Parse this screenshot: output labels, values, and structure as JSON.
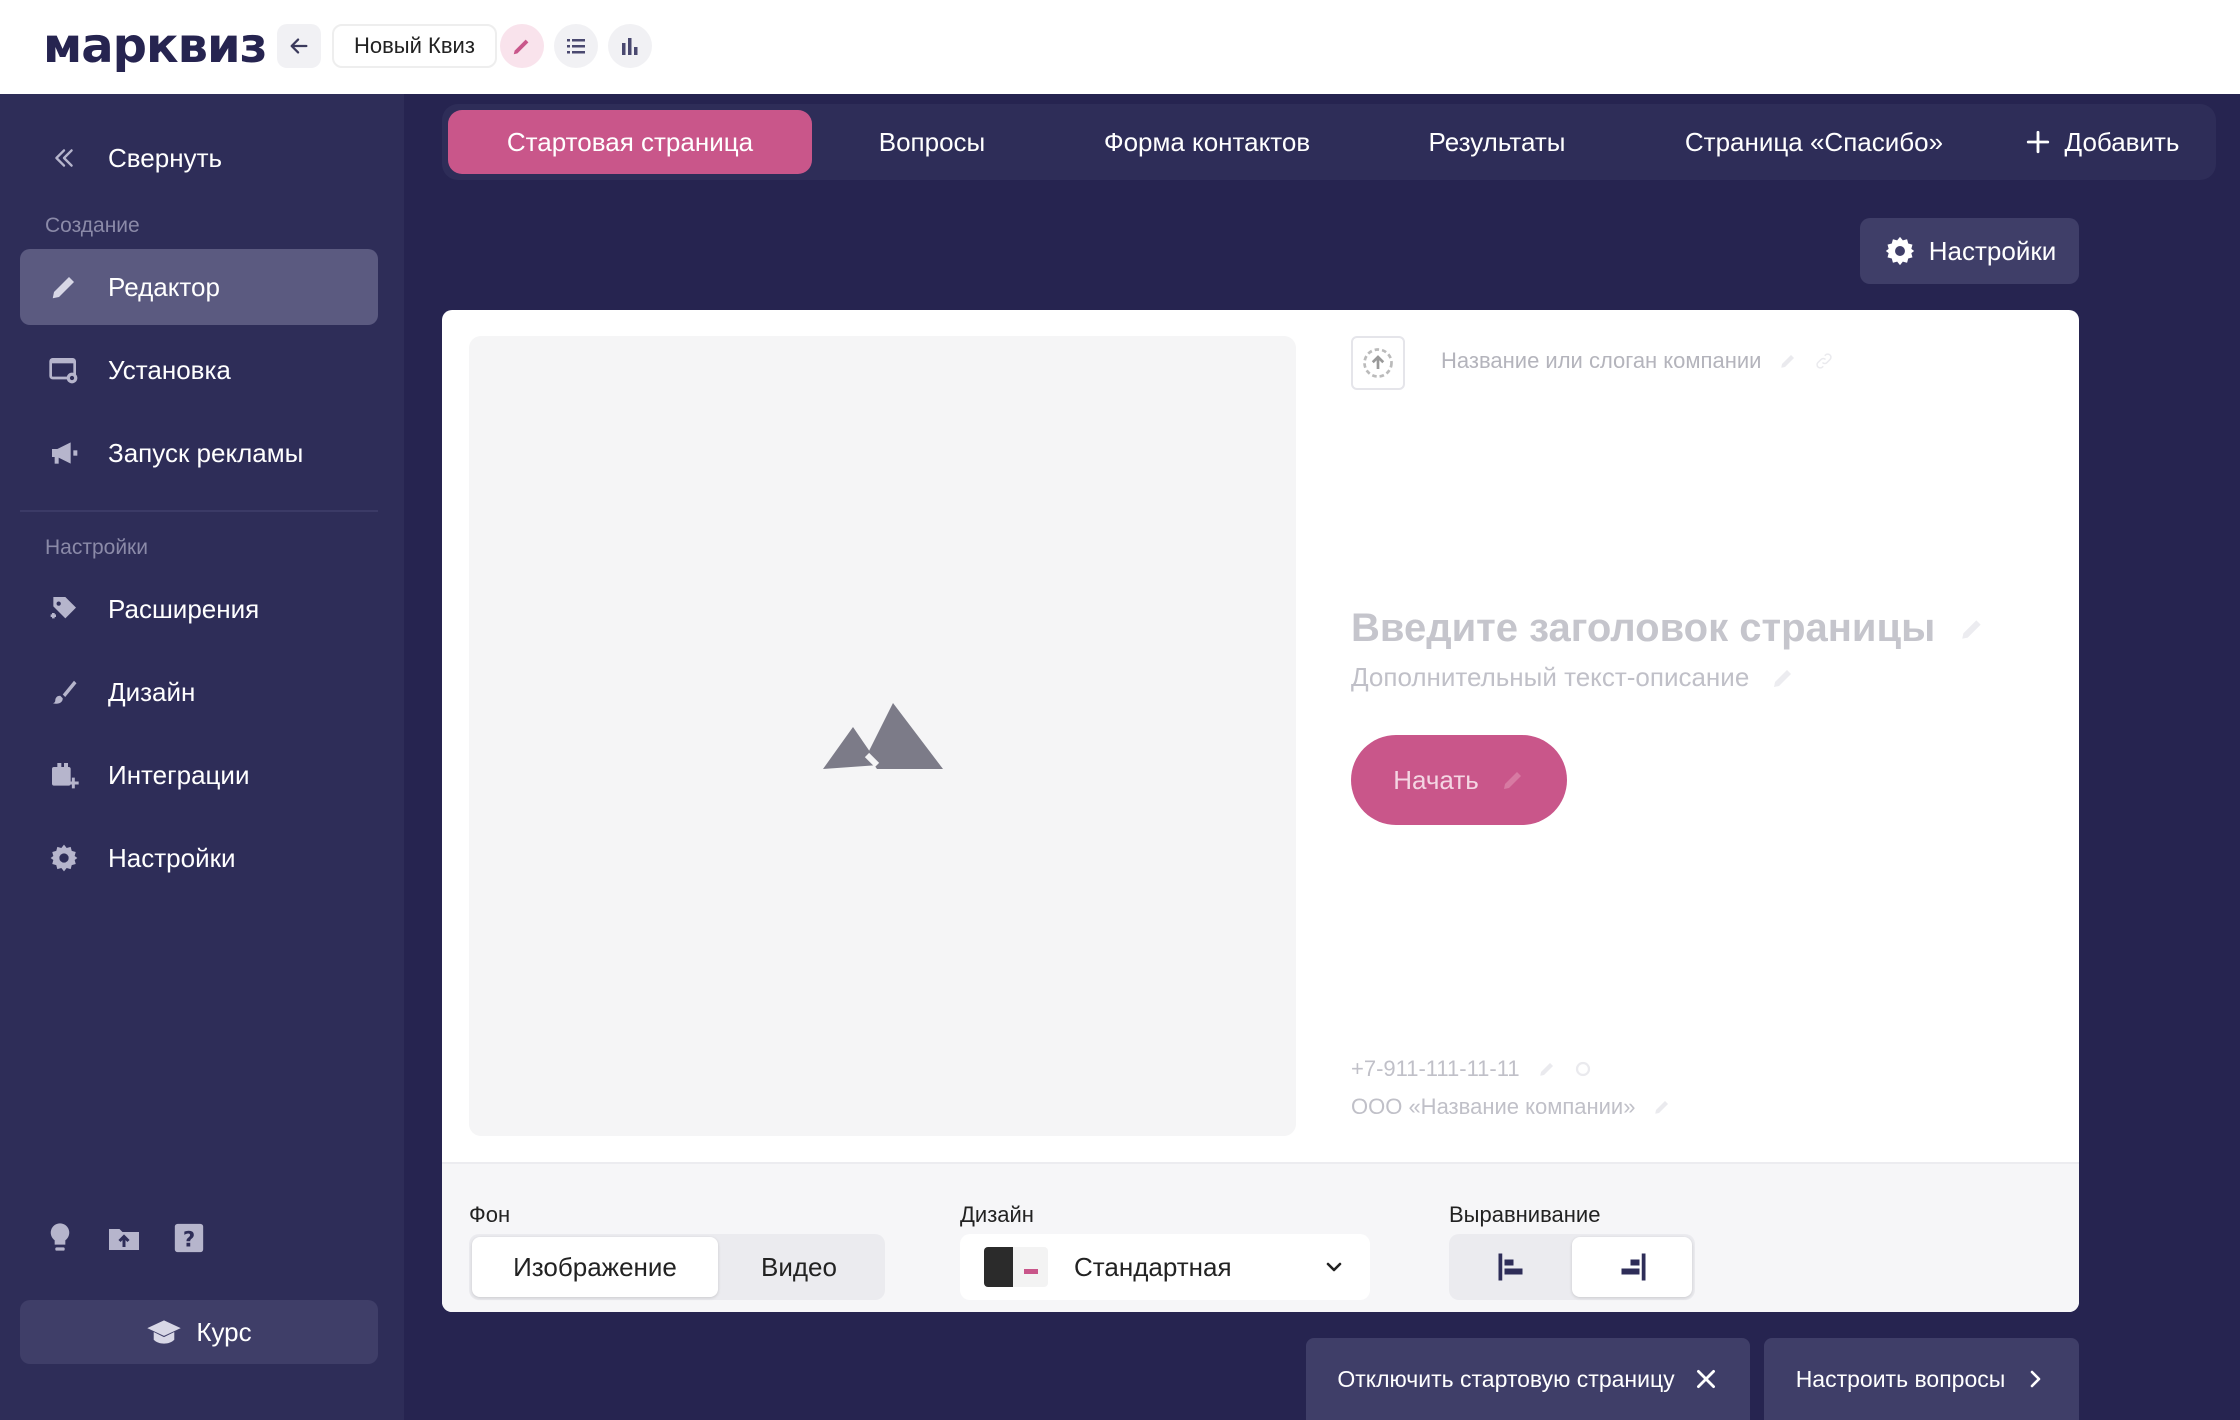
{
  "app": {
    "logo_text": "марквиз",
    "quiz_name": "Новый Квиз"
  },
  "sidebar": {
    "collapse_label": "Свернуть",
    "section_create": "Создание",
    "section_settings": "Настройки",
    "items": [
      {
        "label": "Редактор",
        "icon": "pencil-icon",
        "active": true
      },
      {
        "label": "Установка",
        "icon": "install-icon"
      },
      {
        "label": "Запуск рекламы",
        "icon": "megaphone-icon"
      },
      {
        "label": "Расширения",
        "icon": "extension-icon"
      },
      {
        "label": "Дизайн",
        "icon": "brush-icon"
      },
      {
        "label": "Интеграции",
        "icon": "integration-icon"
      },
      {
        "label": "Настройки",
        "icon": "gear-icon"
      }
    ],
    "course_label": "Курс"
  },
  "tabs": [
    {
      "label": "Стартовая страница",
      "active": true
    },
    {
      "label": "Вопросы"
    },
    {
      "label": "Форма контактов"
    },
    {
      "label": "Результаты"
    },
    {
      "label": "Страница «Спасибо»"
    },
    {
      "label": "Добавить"
    }
  ],
  "settings_button": "Настройки",
  "start_page": {
    "slogan_placeholder": "Название или слоган компании",
    "heading_placeholder": "Введите заголовок страницы",
    "subtext_placeholder": "Дополнительный текст-описание",
    "start_button": "Начать",
    "phone": "+7-911-111-11-11",
    "company": "ООО «Название компании»"
  },
  "footer": {
    "background_label": "Фон",
    "background_options": [
      "Изображение",
      "Видео"
    ],
    "background_selected": "Изображение",
    "design_label": "Дизайн",
    "design_value": "Стандартная",
    "align_label": "Выравнивание",
    "align_selected": "right"
  },
  "actions": {
    "disable_start": "Отключить стартовую страницу",
    "setup_questions": "Настроить вопросы"
  },
  "colors": {
    "accent": "#c9568a",
    "sidebar_bg": "#2e2d58",
    "page_bg": "#262450"
  }
}
